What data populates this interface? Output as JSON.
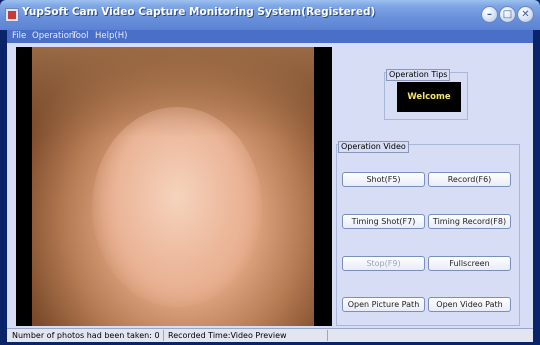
{
  "window": {
    "title": "YupSoft Cam Video Capture Monitoring System(Registered)"
  },
  "title_buttons": {
    "minimize": "–",
    "maximize": "□",
    "close": "✕"
  },
  "menu": [
    "File",
    "Operation",
    "Tool",
    "Help(H)"
  ],
  "operation_tips": {
    "label": "Operation Tips",
    "message": "Welcome"
  },
  "operation_video": {
    "label": "Operation Video",
    "buttons": [
      "Shot(F5)",
      "Record(F6)",
      "Timing Shot(F7)",
      "Timing Record(F8)",
      "Stop(F9)",
      "Fullscreen",
      "Open Picture Path",
      "Open Video Path"
    ]
  },
  "status": {
    "photos_taken": "Number of photos had been taken: 0",
    "recorded": "Recorded Time:Video Preview"
  }
}
